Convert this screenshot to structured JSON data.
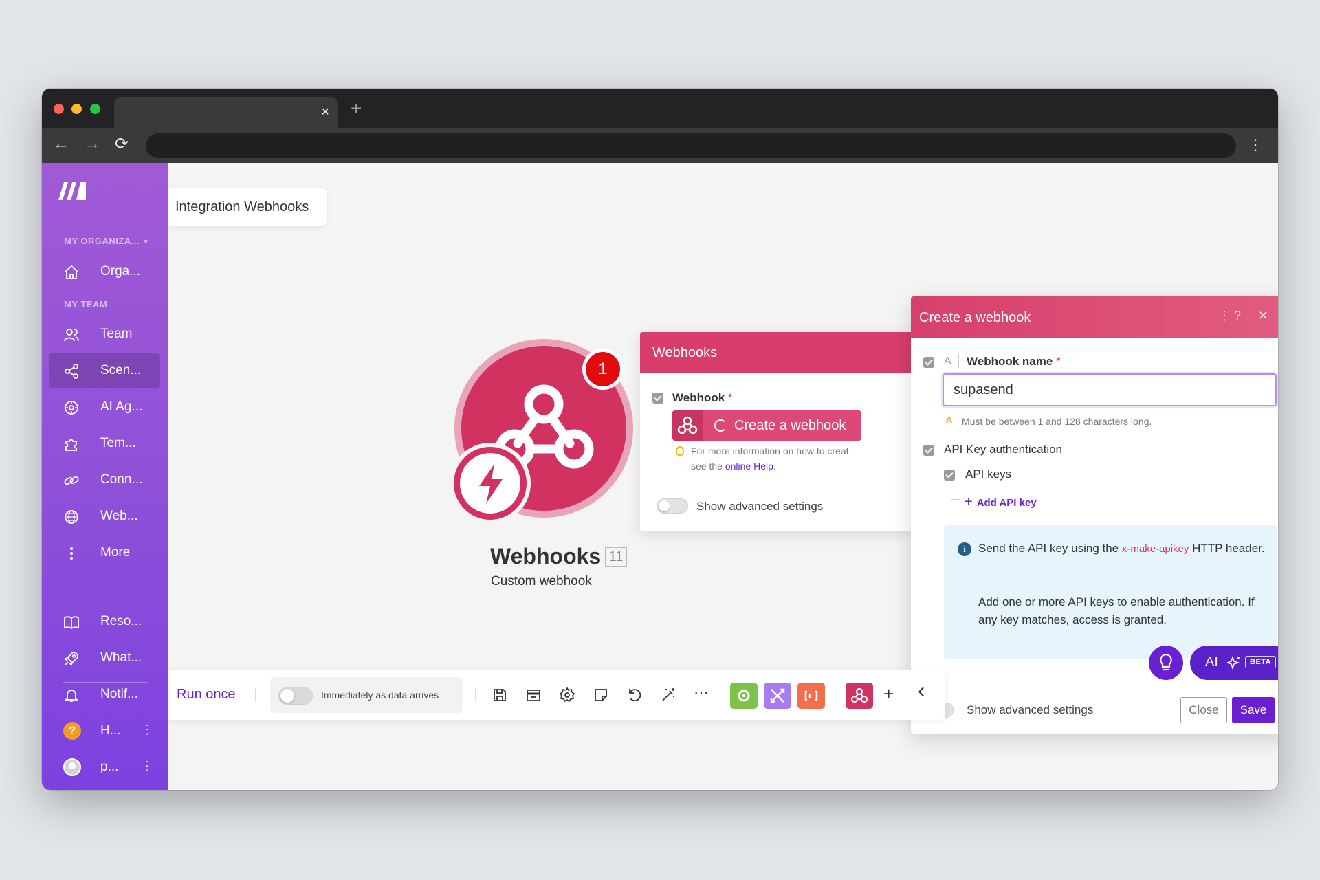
{
  "browser": {
    "tab_close": "×",
    "new_tab": "+",
    "back": "←",
    "forward": "→",
    "reload": "⟳",
    "menu": "⋮"
  },
  "sidebar": {
    "org_section": "MY ORGANIZA...",
    "team_section": "MY TEAM",
    "items": [
      {
        "label": "Orga...",
        "icon": "home-icon"
      },
      {
        "label": "Team",
        "icon": "users-icon"
      },
      {
        "label": "Scen...",
        "icon": "share-nodes-icon",
        "active": true
      },
      {
        "label": "AI Ag...",
        "icon": "ai-agent-icon"
      },
      {
        "label": "Tem...",
        "icon": "puzzle-icon"
      },
      {
        "label": "Conn...",
        "icon": "link-icon"
      },
      {
        "label": "Web...",
        "icon": "globe-icon"
      },
      {
        "label": "More",
        "icon": "dots-vertical-icon"
      }
    ],
    "bottom_items": [
      {
        "label": "Reso...",
        "icon": "book-icon"
      },
      {
        "label": "What...",
        "icon": "rocket-icon"
      },
      {
        "label": "Notif...",
        "icon": "bell-icon"
      },
      {
        "label": "H...",
        "icon": "help-icon",
        "glyph": "?"
      },
      {
        "label": "p...",
        "icon": "avatar"
      }
    ]
  },
  "canvas": {
    "breadcrumb": "Integration Webhooks",
    "module": {
      "title": "Webhooks",
      "count": "11",
      "subtitle": "Custom webhook",
      "badge": "1",
      "colors": {
        "main": "#d2325f",
        "ring": "#e9a5b8"
      }
    }
  },
  "webhooks_panel": {
    "title": "Webhooks",
    "field_label": "Webhook",
    "required_mark": "*",
    "create_button": "Create a webhook",
    "hint_line1": "For more information on how to creat",
    "hint_line2_prefix": "see the ",
    "hint_link": "online Help",
    "hint_line2_suffix": ".",
    "advanced": "Show advanced settings"
  },
  "dialog": {
    "title": "Create a webhook",
    "header_icons": {
      "more": "⋮",
      "help": "?",
      "close": "✕"
    },
    "type_indicator": "A",
    "name_label": "Webhook name",
    "required_mark": "*",
    "name_value": "supasend",
    "warning_icon": "A",
    "validation": "Must be between 1 and 128 characters long.",
    "api_auth_label": "API Key authentication",
    "api_keys_label": "API keys",
    "add_key_plus": "+",
    "add_key": "Add API key",
    "info_icon": "i",
    "info_text_1_prefix": "Send the API key using the ",
    "info_text_1_code": "x-make-apikey",
    "info_text_1_suffix": " HTTP header.",
    "info_text_2": "Add one or more API keys to enable authentication. If any key matches, access is granted.",
    "advanced": "Show advanced settings",
    "close_button": "Close",
    "save_button": "Save"
  },
  "bottombar": {
    "run_once": "Run once",
    "schedule": "Immediately as data arrives",
    "more": "···",
    "add": "+",
    "collapse": "‹",
    "tiles": [
      {
        "name": "tools-tile",
        "color": "#7ec24a"
      },
      {
        "name": "flow-control-tile",
        "color": "#a77cf0"
      },
      {
        "name": "text-parser-tile",
        "color": "#f26f4c"
      },
      {
        "name": "webhooks-tile",
        "color": "#d2325f"
      }
    ]
  },
  "floating": {
    "ai_label": "AI",
    "beta": "BETA",
    "accent": "#6a1fd0"
  }
}
